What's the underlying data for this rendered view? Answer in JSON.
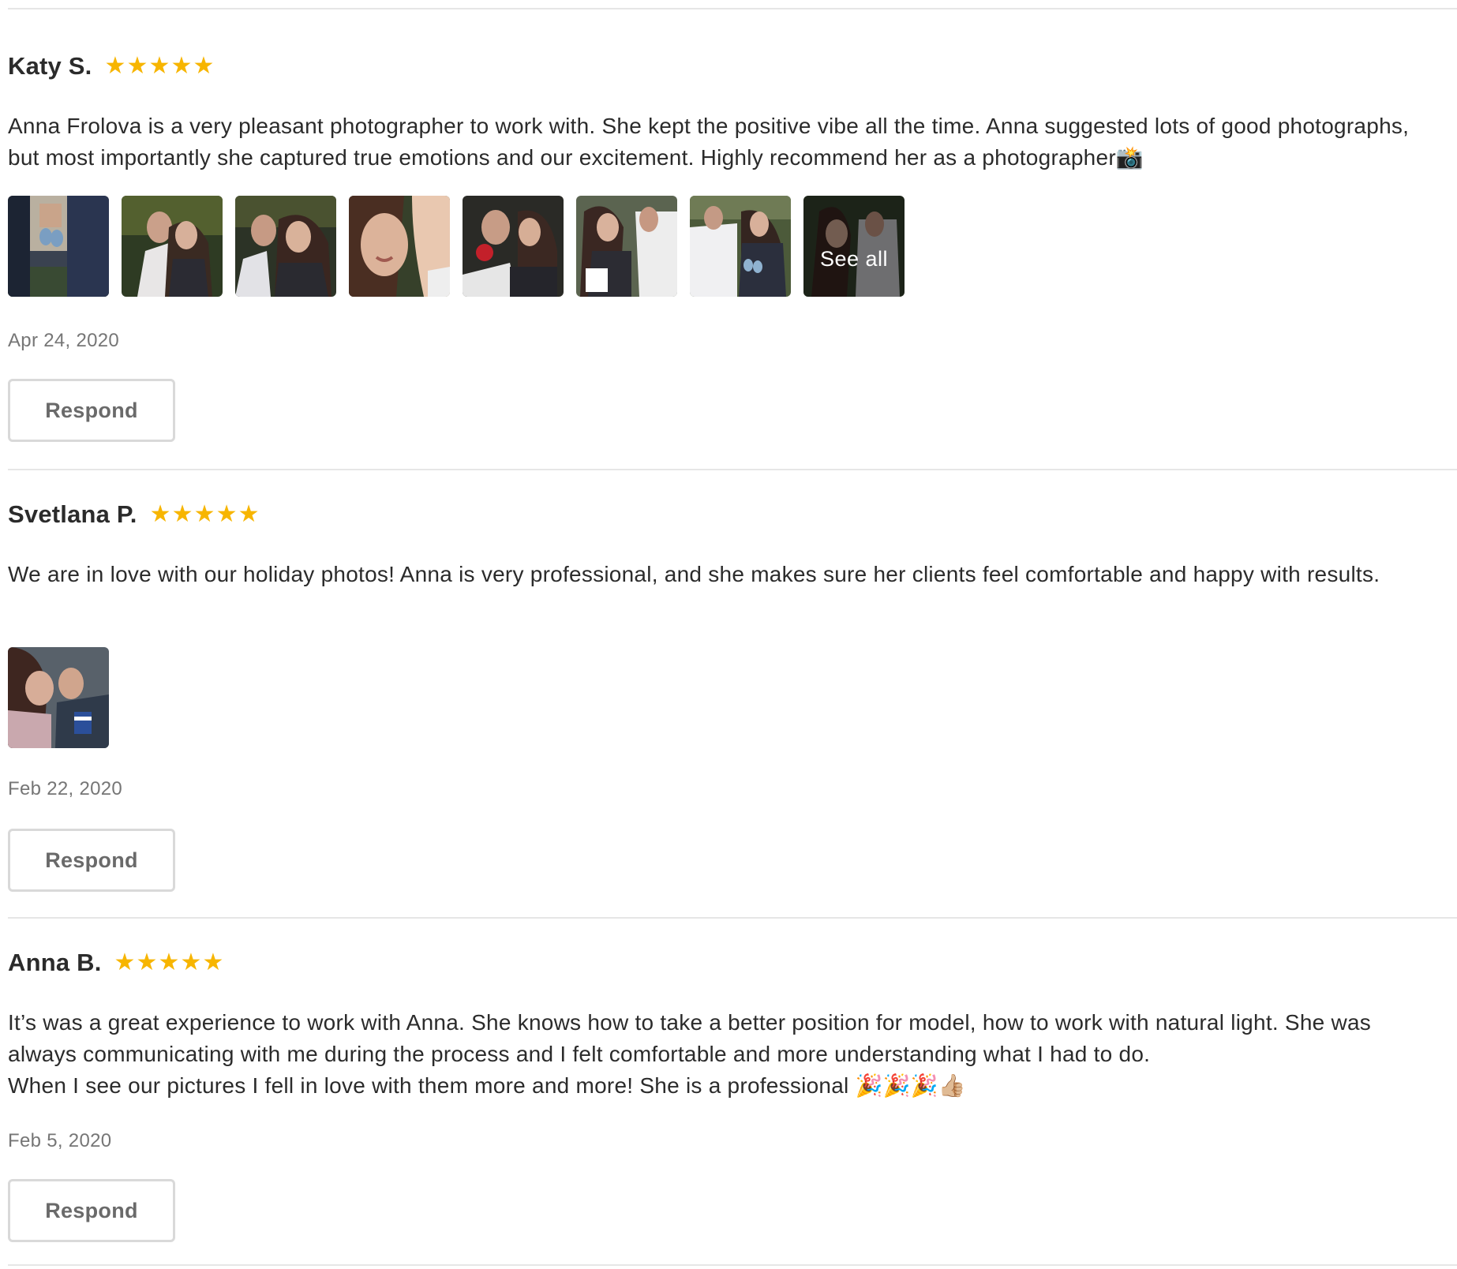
{
  "colors": {
    "star": "#f7b500",
    "text": "#2b2b2b",
    "date": "#767676",
    "divider": "#e6e6e6",
    "button_border": "#d9d9d9",
    "button_text": "#6a6a6a"
  },
  "reviews": [
    {
      "reviewer": "Katy S.",
      "rating": 5,
      "text": "Anna Frolova is a very pleasant photographer to work with. She kept the positive vibe all the time. Anna suggested lots of good photographs, but most importantly she captured true emotions and our excitement. Highly recommend her as a photographer📸",
      "photos": [
        "photo-baby-shoes",
        "photo-couple-embrace",
        "photo-couple-kiss-cheek",
        "photo-face-closeup",
        "photo-couple-rose",
        "photo-coming-soon-onesie",
        "photo-couple-holding-shoes",
        "photo-couple-see-all"
      ],
      "see_all_label": "See all",
      "date": "Apr 24, 2020",
      "respond_label": "Respond"
    },
    {
      "reviewer": "Svetlana P.",
      "rating": 5,
      "text": "We are in love with our holiday photos! Anna is very professional, and she makes sure her clients feel comfortable and happy with results.",
      "photos": [
        "photo-couple-holiday"
      ],
      "date": "Feb 22, 2020",
      "respond_label": "Respond"
    },
    {
      "reviewer": "Anna B.",
      "rating": 5,
      "text": "It’s was a great experience to work with Anna. She knows how to take a better position for model, how to work with natural light. She was always communicating with me during the process and I felt comfortable and more understanding what I had to do.\nWhen I see our pictures I fell in love with them more and more! She is a professional 🎉🎉🎉👍🏼",
      "date": "Feb 5, 2020",
      "respond_label": "Respond"
    }
  ]
}
